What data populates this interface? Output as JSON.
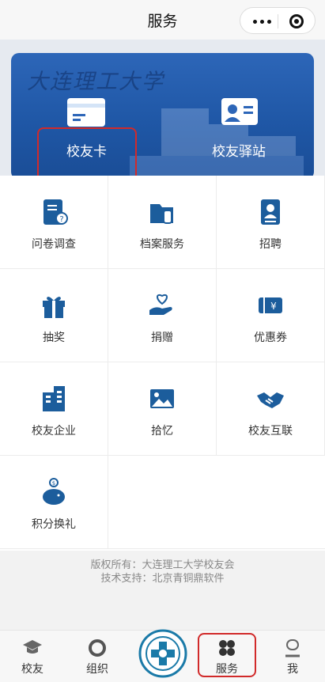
{
  "topbar": {
    "title": "服务"
  },
  "banner": {
    "university": "大连理工大学",
    "items": [
      {
        "label": "校友卡",
        "icon": "card-icon"
      },
      {
        "label": "校友驿站",
        "icon": "id-badge-icon"
      }
    ]
  },
  "services": [
    {
      "label": "问卷调查",
      "icon": "questionnaire-icon"
    },
    {
      "label": "档案服务",
      "icon": "folder-hand-icon"
    },
    {
      "label": "招聘",
      "icon": "resume-icon"
    },
    {
      "label": "抽奖",
      "icon": "gift-icon"
    },
    {
      "label": "捐赠",
      "icon": "heart-hand-icon"
    },
    {
      "label": "优惠券",
      "icon": "coupon-icon"
    },
    {
      "label": "校友企业",
      "icon": "building-icon"
    },
    {
      "label": "拾忆",
      "icon": "photo-icon"
    },
    {
      "label": "校友互联",
      "icon": "handshake-icon"
    },
    {
      "label": "积分换礼",
      "icon": "piggy-bank-icon"
    }
  ],
  "footer": {
    "copyright": "版权所有：大连理工大学校友会",
    "support": "技术支持：北京青铜鼎软件"
  },
  "tabbar": {
    "items": [
      {
        "label": "校友",
        "icon": "graduation-cap-icon"
      },
      {
        "label": "组织",
        "icon": "ring-icon"
      },
      {
        "label": "",
        "icon": "university-seal-icon"
      },
      {
        "label": "服务",
        "icon": "clover-icon",
        "selected": true
      },
      {
        "label": "我",
        "icon": "person-icon"
      }
    ]
  },
  "colors": {
    "brand_blue": "#1f5aa8",
    "highlight_red": "#d12a2a",
    "icon_blue": "#1c5d9c"
  }
}
